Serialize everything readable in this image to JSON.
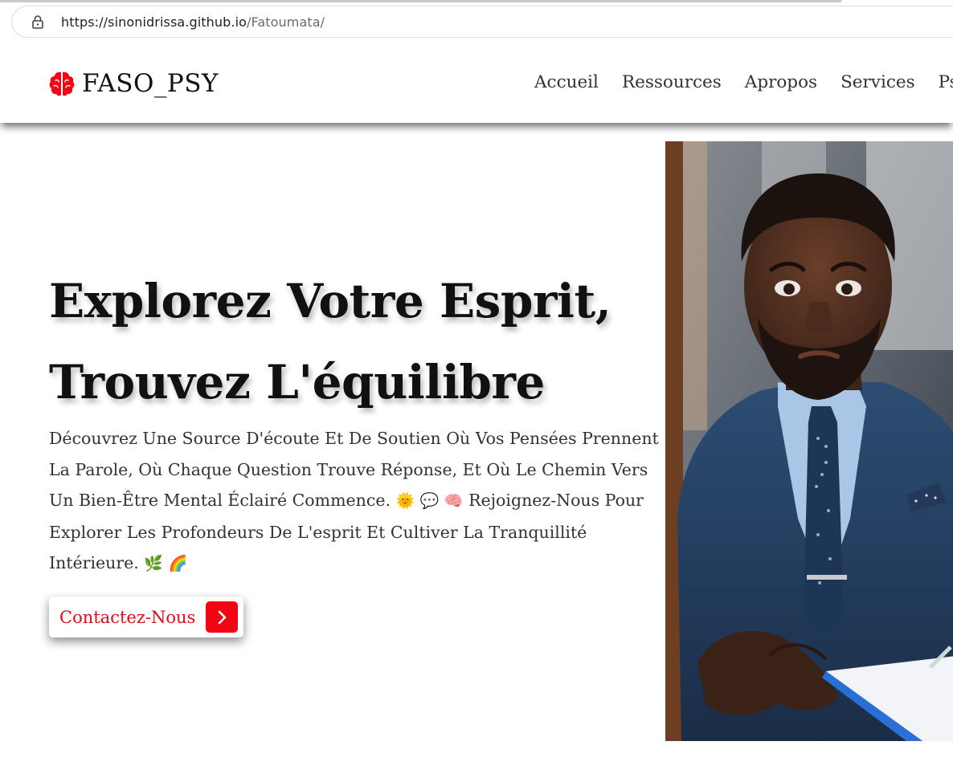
{
  "browser": {
    "url_host": "https://sinonidrissa.github.io",
    "url_path": "/Fatoumata/"
  },
  "navbar": {
    "brand": "FASO_PSY",
    "brand_icon": "brain-icon",
    "links": [
      "Accueil",
      "Ressources",
      "Apropos",
      "Services",
      "Psy"
    ]
  },
  "hero": {
    "title_line1": "Explorez Votre Esprit,",
    "title_line2": "Trouvez L'équilibre",
    "paragraph_a": "Découvrez Une Source D'écoute Et De Soutien Où Vos Pensées Prennent La Parole, Où Chaque Question Trouve Réponse, Et Où Le Chemin Vers Un Bien-Être Mental Éclairé Commence. ",
    "emoji_a": [
      "🌞",
      "💬",
      "🧠"
    ],
    "paragraph_b": "Rejoignez-Nous Pour Explorer Les Profondeurs De L'esprit Et Cultiver La Tranquillité Intérieure. ",
    "emoji_b": [
      "🌿",
      "🌈"
    ],
    "cta_label": "Contactez-Nous",
    "cta_icon": "chevron-right-icon"
  },
  "colors": {
    "accent": "#f20515",
    "cta_text": "#e30a1a",
    "text": "#333333",
    "title": "#111111"
  }
}
